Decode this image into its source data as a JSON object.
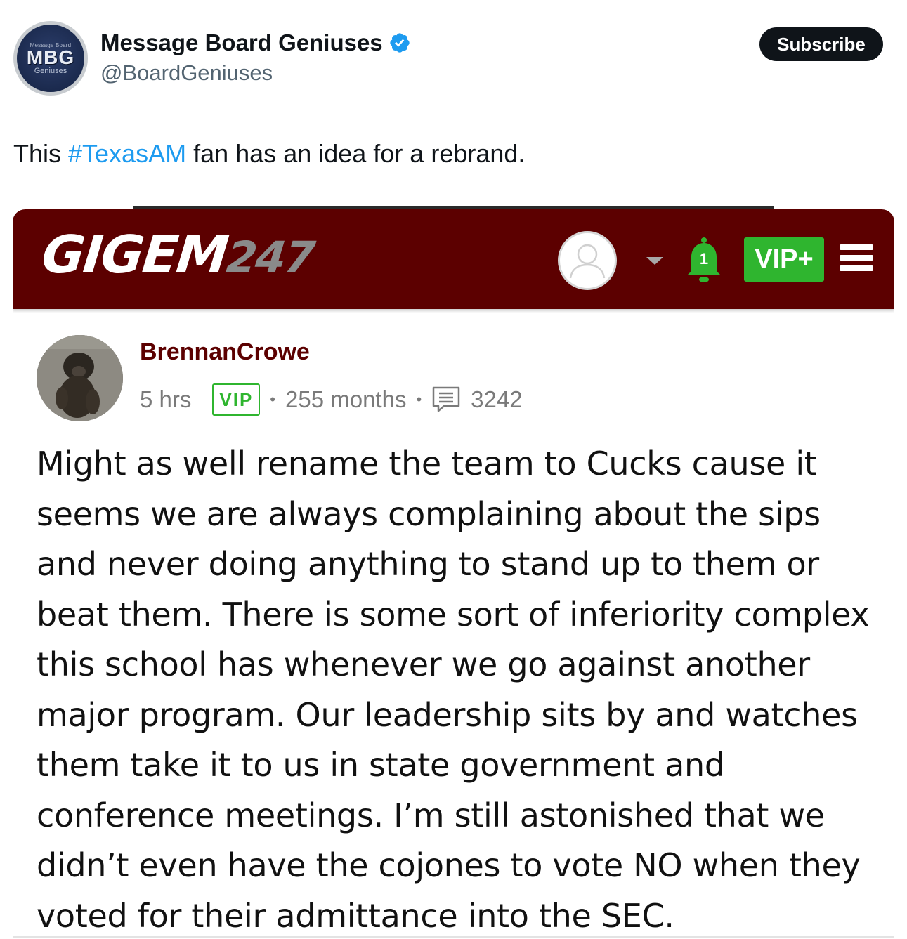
{
  "tweet": {
    "display_name": "Message Board Geniuses",
    "handle": "@BoardGeniuses",
    "subscribe_label": "Subscribe",
    "avatar": {
      "top_text": "Message Board",
      "logo_text": "MBG",
      "bottom_text": "Geniuses"
    },
    "text_before": "This ",
    "hashtag": "#TexasAM",
    "text_after": " fan has an idea for a rebrand."
  },
  "site": {
    "logo_text": "GIGEM",
    "logo_number": "247",
    "notification_count": "1",
    "vip_plus_label": "VIP+",
    "colors": {
      "bar": "#5c0000",
      "vip_green": "#2fb52f"
    }
  },
  "post": {
    "username": "BrennanCrowe",
    "time": "5 hrs",
    "badge": "VIP",
    "membership": "255 months",
    "comment_count": "3242",
    "body": "Might as well rename the team to Cucks cause it seems we are always complaining about the sips and never doing anything to stand up to them or beat them. There is some sort of inferiority complex this school has whenever we go against another major program. Our leadership sits by and watches them take it to us in state government and conference meetings. I’m still astonished that we didn’t even have the cojones to vote NO when they voted for their admittance into the SEC."
  }
}
